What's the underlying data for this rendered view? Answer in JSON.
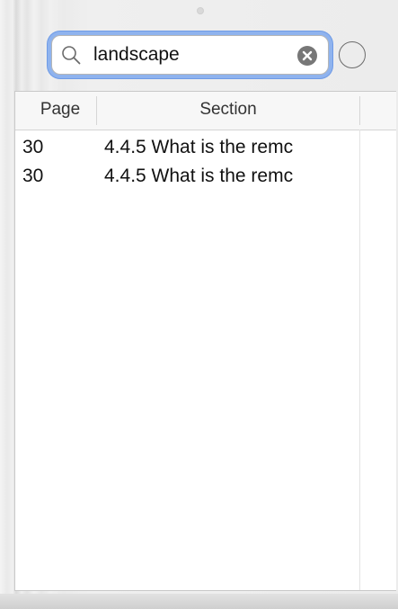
{
  "search": {
    "query": "landscape",
    "icon": "magnifying-glass",
    "clear_icon": "x-circle"
  },
  "table": {
    "columns": [
      "Page",
      "Section"
    ],
    "rows": [
      {
        "page": "30",
        "section": "4.4.5 What is the remc"
      },
      {
        "page": "30",
        "section": "4.4.5 What is the remc"
      }
    ]
  },
  "colors": {
    "focus_ring": "#8fb3ee",
    "clear_button": "#777777",
    "table_background": "#ffffff",
    "chrome_background": "#ececec"
  }
}
